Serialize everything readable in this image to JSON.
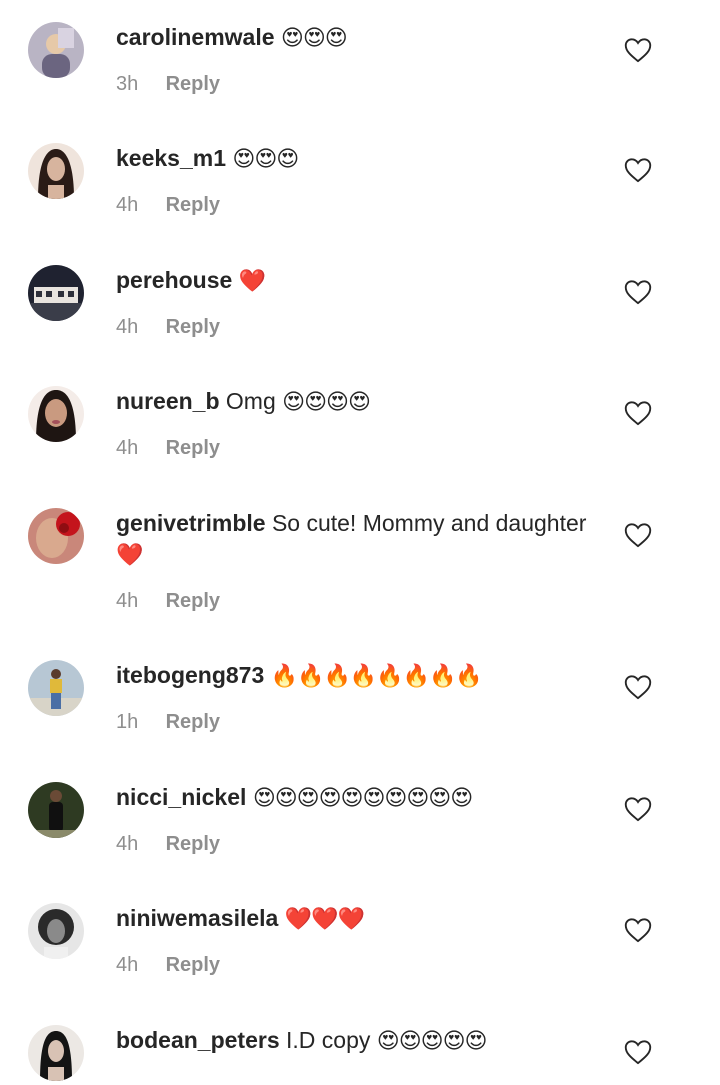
{
  "comments": [
    {
      "username": "carolinemwale",
      "text": "",
      "emoji": "😍😍😍",
      "time": "3h",
      "reply": "Reply",
      "avatar_color": "#b9b4c4"
    },
    {
      "username": "keeks_m1",
      "text": "",
      "emoji": "😍😍😍",
      "time": "4h",
      "reply": "Reply",
      "avatar_color": "#d7b49e"
    },
    {
      "username": "perehouse",
      "text": "",
      "emoji": "❤️",
      "time": "4h",
      "reply": "Reply",
      "avatar_color": "#2d2f3a"
    },
    {
      "username": "nureen_b",
      "text": "Omg",
      "emoji": "😍😍😍😍",
      "time": "4h",
      "reply": "Reply",
      "avatar_color": "#c99a80"
    },
    {
      "username": "genivetrimble",
      "text": "So cute! Mommy and daughter",
      "emoji": "❤️",
      "time": "4h",
      "reply": "Reply",
      "avatar_color": "#a0523f"
    },
    {
      "username": "itebogeng873",
      "text": "",
      "emoji": "🔥🔥🔥🔥🔥🔥🔥🔥",
      "time": "1h",
      "reply": "Reply",
      "avatar_color": "#9fb6c8"
    },
    {
      "username": "nicci_nickel",
      "text": "",
      "emoji": "😍😍😍😍😍😍😍😍😍😍",
      "time": "4h",
      "reply": "Reply",
      "avatar_color": "#3a4a2c"
    },
    {
      "username": "niniwemasilela",
      "text": "",
      "emoji": "❤️❤️❤️",
      "time": "4h",
      "reply": "Reply",
      "avatar_color": "#8a8a8a"
    },
    {
      "username": "bodean_peters",
      "text": "I.D copy",
      "emoji": "😍😍😍😍😍",
      "time": "4h",
      "reply": "Reply",
      "avatar_color": "#c8c2be"
    }
  ],
  "icons": {
    "like": "heart-outline-icon"
  }
}
